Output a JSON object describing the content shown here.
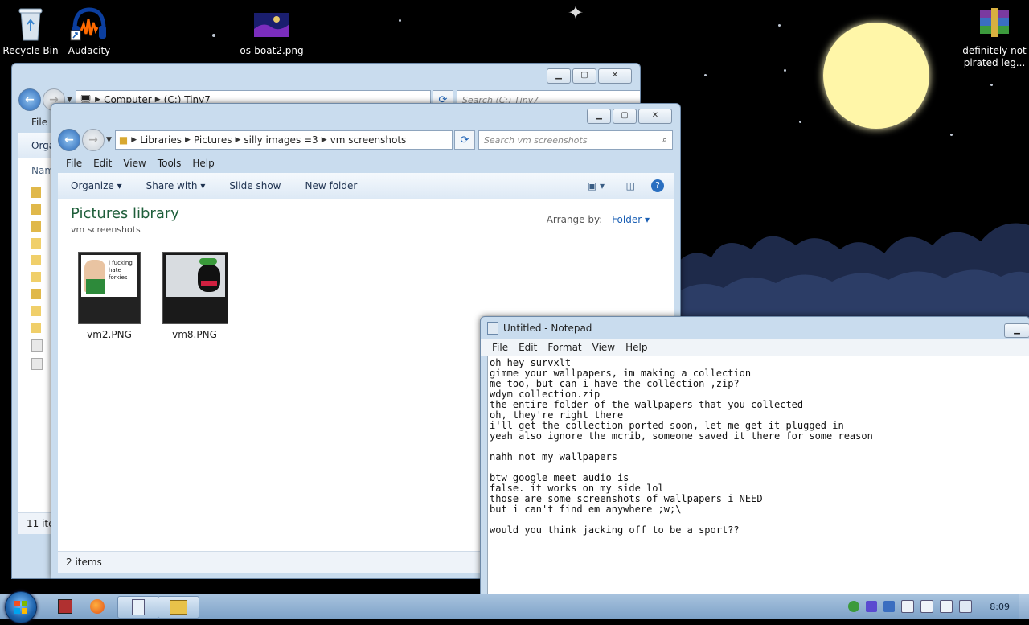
{
  "desktop": {
    "icons": [
      {
        "label": "Recycle Bin",
        "icon": "recycle-bin-icon"
      },
      {
        "label": "Audacity",
        "icon": "audacity-icon"
      },
      {
        "label": "os-boat2.png",
        "icon": "image-file-icon"
      },
      {
        "label": "definitely not pirated leg...",
        "icon": "winrar-archive-icon"
      }
    ]
  },
  "back_explorer": {
    "address": [
      "Computer",
      "(C:) Tiny7"
    ],
    "search_placeholder": "Search (C:) Tiny7",
    "menu_file": "File",
    "cmd_organize": "Orga",
    "column_name": "Nam",
    "status": "11 item"
  },
  "front_explorer": {
    "address": [
      "Libraries",
      "Pictures",
      "silly images =3",
      "vm screenshots"
    ],
    "search_placeholder": "Search vm screenshots",
    "menu": [
      "File",
      "Edit",
      "View",
      "Tools",
      "Help"
    ],
    "commands": [
      "Organize",
      "Share with",
      "Slide show",
      "New folder"
    ],
    "library_title": "Pictures library",
    "library_subtitle": "vm screenshots",
    "arrange_label": "Arrange by:",
    "arrange_value": "Folder",
    "files": [
      {
        "name": "vm2.PNG",
        "thumb_text": "i fucking hate forkies"
      },
      {
        "name": "vm8.PNG",
        "thumb_text": ""
      }
    ],
    "status": "2 items"
  },
  "notepad": {
    "title": "Untitled - Notepad",
    "menu": [
      "File",
      "Edit",
      "Format",
      "View",
      "Help"
    ],
    "lines": [
      "oh hey survxlt",
      "gimme your wallpapers, im making a collection",
      "me too, but can i have the collection ,zip?",
      "wdym collection.zip",
      "the entire folder of the wallpapers that you collected",
      "oh, they're right there",
      "i'll get the collection ported soon, let me get it plugged in",
      "yeah also ignore the mcrib, someone saved it there for some reason",
      "",
      "nahh not my wallpapers",
      "",
      "btw google meet audio is",
      "false. it works on my side lol",
      "those are some screenshots of wallpapers i NEED",
      "but i can't find em anywhere ;w;\\",
      "",
      "would you think jacking off to be a sport??"
    ]
  },
  "taskbar": {
    "clock": "8:09",
    "pinned": [
      "start-orb",
      "app-icon",
      "firefox-icon",
      "notepad-icon",
      "explorer-icon"
    ]
  }
}
